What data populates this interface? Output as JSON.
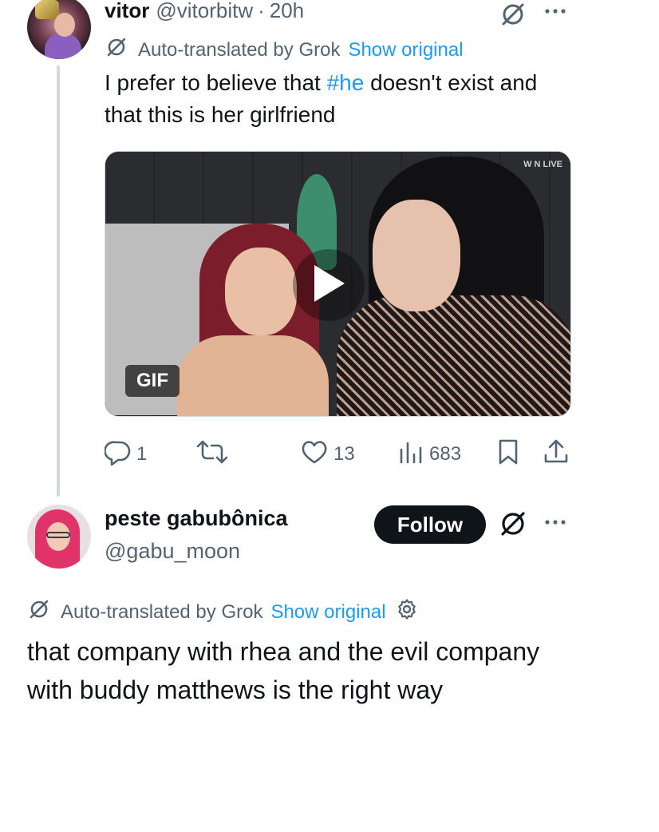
{
  "tweet1": {
    "display_name": "vitor",
    "handle": "@vitorbitw",
    "separator": "·",
    "time": "20h",
    "translation": {
      "label": "Auto-translated by Grok",
      "show_original": "Show original"
    },
    "text_before": "I prefer to believe that ",
    "hashtag": "#he",
    "text_after": " doesn't exist and that this is her girlfriend",
    "media": {
      "badge": "GIF",
      "watermark": "W N LIVE"
    },
    "actions": {
      "replies": "1",
      "reposts": "",
      "likes": "13",
      "views": "683"
    }
  },
  "tweet2": {
    "display_name": "peste gabubônica",
    "handle": "@gabu_moon",
    "follow_label": "Follow",
    "translation": {
      "label": "Auto-translated by Grok",
      "show_original": "Show original"
    },
    "text": "that company with rhea and the evil company with buddy matthews is the right way"
  },
  "icons": {
    "grok": "grok-icon",
    "more": "more-icon",
    "reply": "reply-icon",
    "repost": "repost-icon",
    "like": "like-icon",
    "views": "views-icon",
    "bookmark": "bookmark-icon",
    "share": "share-icon",
    "settings": "gear-icon",
    "play": "play-icon"
  },
  "colors": {
    "accent": "#1d9bf0",
    "text": "#0f1419",
    "secondary": "#536471",
    "thread_line": "#cfd9de"
  }
}
